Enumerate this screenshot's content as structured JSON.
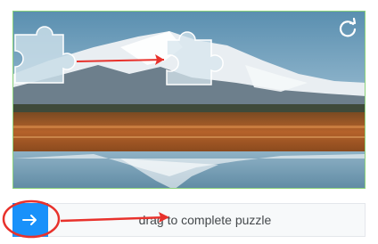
{
  "captcha": {
    "slider": {
      "hint": "drag to complete puzzle"
    }
  },
  "icons": {
    "refresh": "refresh-icon",
    "handle": "arrow-right-icon"
  },
  "colors": {
    "handle": "#1991fa",
    "annotation": "#e8322c",
    "panel_border": "#8cd37a"
  }
}
